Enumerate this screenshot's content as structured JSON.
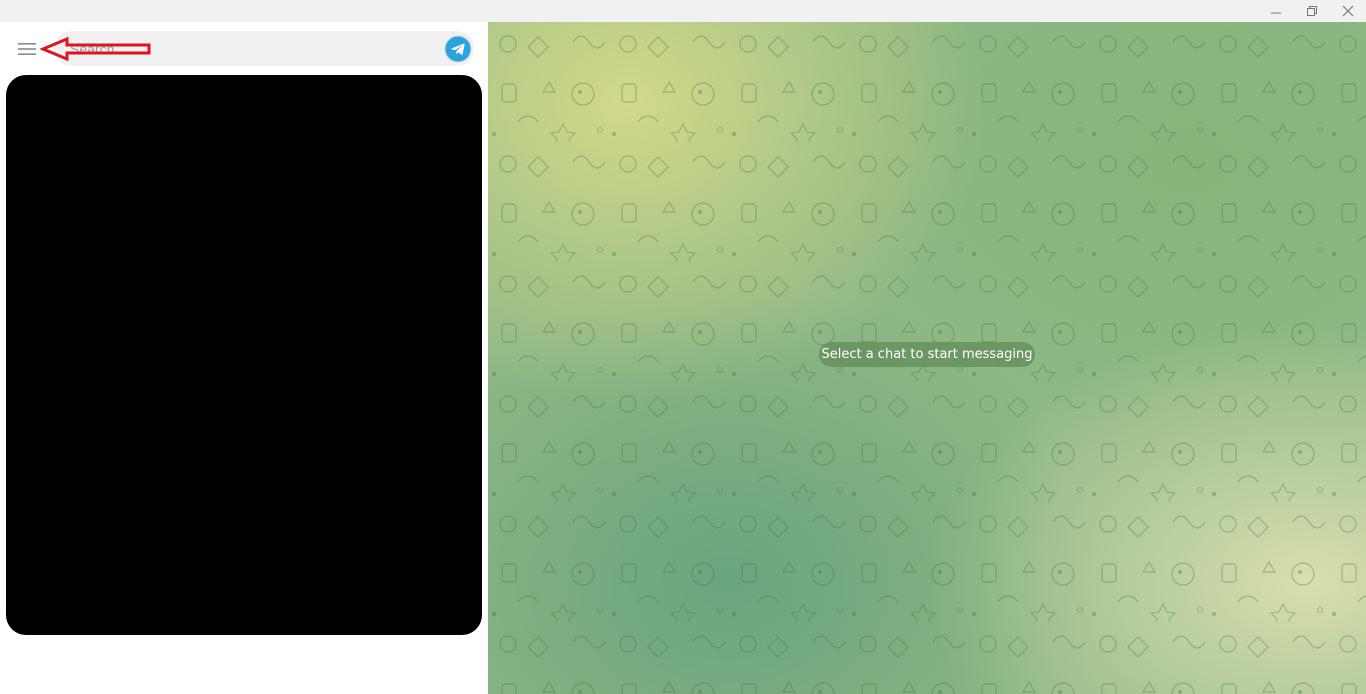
{
  "window": {
    "controls": {
      "minimize_icon": "minimize-icon",
      "restore_icon": "restore-icon",
      "close_icon": "close-icon"
    }
  },
  "sidebar": {
    "menu_icon": "hamburger-menu-icon",
    "search": {
      "placeholder": "Search",
      "value": ""
    },
    "logo_icon": "telegram-logo-icon",
    "chat_list": "redacted"
  },
  "annotation": {
    "shape": "red-arrow-pointing-left",
    "color": "#e0141e"
  },
  "chat": {
    "empty_message": "Select a chat to start messaging"
  },
  "colors": {
    "accent": "#2aa3e0",
    "pill_bg": "#628c58",
    "search_bg": "#f1f1f1"
  }
}
